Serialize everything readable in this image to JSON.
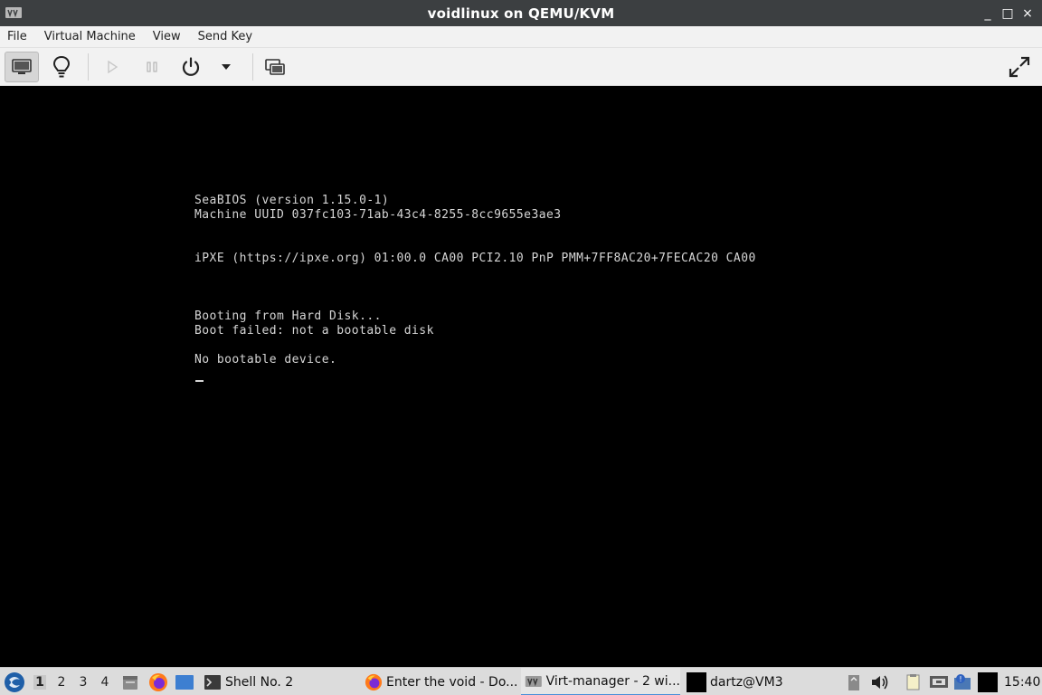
{
  "window": {
    "title": "voidlinux on QEMU/KVM",
    "buttons": [
      "_",
      "□",
      "×"
    ]
  },
  "menu": [
    "File",
    "Virtual Machine",
    "View",
    "Send Key"
  ],
  "toolbar": {
    "buttons": [
      {
        "name": "console-view-icon",
        "active": true
      },
      {
        "name": "details-lightbulb-icon"
      },
      {
        "name": "run-icon",
        "disabled": true
      },
      {
        "name": "pause-icon",
        "disabled": true
      },
      {
        "name": "power-icon"
      },
      {
        "name": "power-dropdown-icon"
      },
      {
        "name": "snapshots-icon"
      },
      {
        "name": "fullscreen-icon"
      }
    ]
  },
  "console": {
    "lines": [
      "SeaBIOS (version 1.15.0-1)",
      "Machine UUID 037fc103-71ab-43c4-8255-8cc9655e3ae3",
      "iPXE (https://ipxe.org) 01:00.0 CA00 PCI2.10 PnP PMM+7FF8AC20+7FECAC20 CA00",
      "Booting from Hard Disk...",
      "Boot failed: not a bootable disk",
      "No bootable device."
    ]
  },
  "taskbar": {
    "workspaces": [
      "1",
      "2",
      "3",
      "4"
    ],
    "active_workspace": "1",
    "tasks": [
      {
        "label": "Shell No. 2",
        "icon": "terminal-icon"
      },
      {
        "label": "Enter the void - Do...",
        "icon": "firefox-icon"
      },
      {
        "label": "Virt-manager - 2 wi...",
        "icon": "virt-manager-icon",
        "active": true
      },
      {
        "label": "dartz@VM3",
        "icon": "terminal-black-icon"
      }
    ],
    "clock": "15:40"
  }
}
